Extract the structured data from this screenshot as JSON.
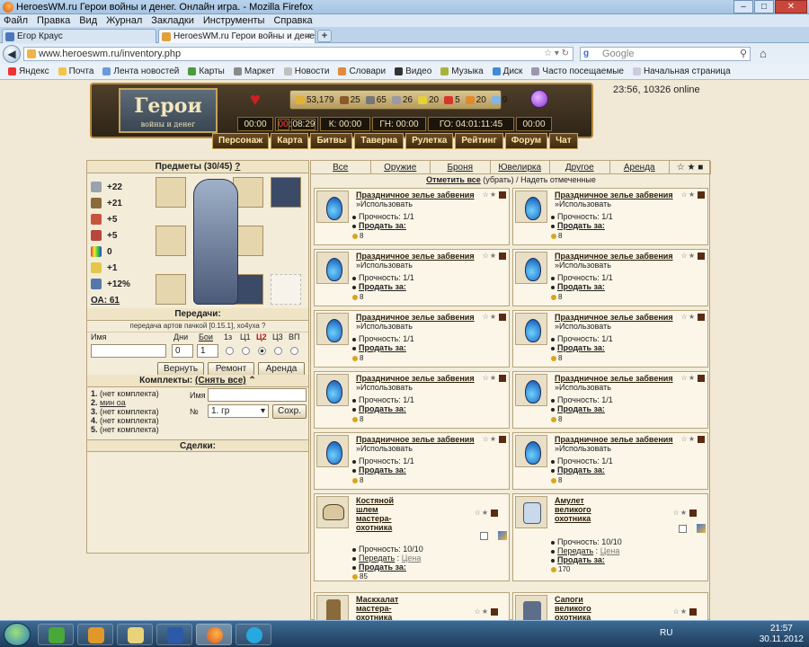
{
  "window": {
    "title": "HeroesWM.ru Герои войны и денег. Онлайн игра. - Mozilla Firefox"
  },
  "menu": [
    "Файл",
    "Правка",
    "Вид",
    "Журнал",
    "Закладки",
    "Инструменты",
    "Справка"
  ],
  "tabs": [
    {
      "label": "Егор Краус"
    },
    {
      "label": "HeroesWM.ru Герои войны и денег..."
    }
  ],
  "nav": {
    "url": "www.heroeswm.ru/inventory.php",
    "search_placeholder": "Google"
  },
  "bookmarks": [
    "Яндекс",
    "Почта",
    "Лента новостей",
    "Карты",
    "Маркет",
    "Новости",
    "Словари",
    "Видео",
    "Музыка",
    "Диск",
    "Часто посещаемые",
    "Начальная страница"
  ],
  "game": {
    "logo": "Герои",
    "logo_sub": "войны и денег",
    "clock": "23:56, 10326 online",
    "resources": [
      "53,179",
      "25",
      "65",
      "26",
      "20",
      "5",
      "20",
      "9"
    ],
    "timers": [
      "00:00",
      "08:29",
      "К: 00:00",
      "ГН: 00:00",
      "ГО: 04:01:11:45",
      "00:00"
    ],
    "timer_prefix": "00",
    "nav": [
      "Персонаж",
      "Карта",
      "Битвы",
      "Таверна",
      "Рулетка",
      "Рейтинг",
      "Форум",
      "Чат"
    ]
  },
  "left": {
    "items_title": "Предметы (30/45)",
    "help": "?",
    "stats": [
      "+22",
      "+21",
      "+5",
      "+5",
      "0",
      "+1",
      "+12%"
    ],
    "oa": "ОА: 61",
    "transfers_title": "Передачи:",
    "transfer_note": "передача артов пачкой [0.15.1], хо4уха",
    "col_name": "Имя",
    "col_days": "Дни",
    "col_fights": "Бои",
    "rad_labels": [
      "1з",
      "Ц1",
      "Ц2",
      "Ц3",
      "ВП"
    ],
    "days_value": "0",
    "fights_value": "1",
    "btn_return": "Вернуть",
    "btn_repair": "Ремонт",
    "btn_rent": "Аренда",
    "kits_title": "Комплекты:",
    "kits_clear": "(Снять все)",
    "kits": [
      "(нет комплекта)",
      "мин оа",
      "(нет комплекта)",
      "(нет комплекта)",
      "(нет комплекта)"
    ],
    "kit_name_label": "Имя",
    "kit_no_label": "№",
    "kit_select": "1. гр",
    "kit_save": "Сохр.",
    "deals_title": "Сделки:"
  },
  "right": {
    "categories": [
      "Все",
      "Оружие",
      "Броня",
      "Ювелирка",
      "Другое",
      "Аренда"
    ],
    "mark_all": "Отметить все",
    "mark_rest": "(убрать) / Надеть отмеченные",
    "potion_title": "Праздничное зелье забвения",
    "use": "»Использовать",
    "durability": "Прочность: 1/1",
    "sell": "Продать за:",
    "price": "8",
    "big_items": [
      {
        "title": "Костяной шлем мастера-охотника",
        "durability": "Прочность: 10/10",
        "transfer": "Передать",
        "price_link": "Цена",
        "sell": "Продать за:",
        "price": "85"
      },
      {
        "title": "Амулет великого охотника",
        "durability": "Прочность: 10/10",
        "transfer": "Передать",
        "price_link": "Цена",
        "sell": "Продать за:",
        "price": "170"
      },
      {
        "title": "Маскхалат мастера-охотника"
      },
      {
        "title": "Сапоги великого охотника"
      }
    ]
  },
  "taskbar": {
    "lang": "RU",
    "time": "21:57",
    "date": "30.11.2012"
  }
}
